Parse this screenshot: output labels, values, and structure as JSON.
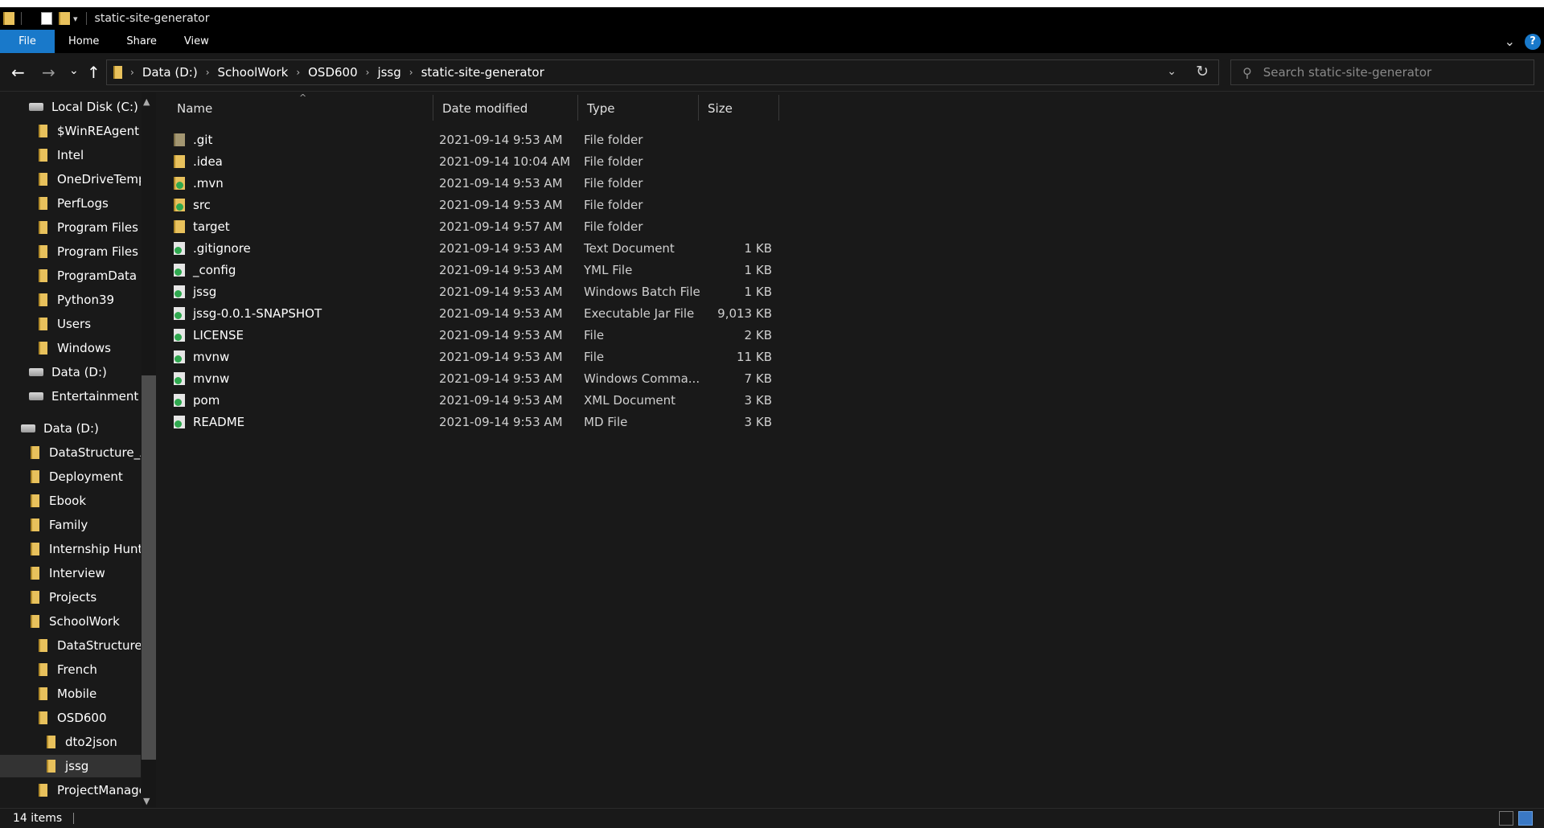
{
  "window": {
    "title": "static-site-generator"
  },
  "ribbon": {
    "tabs": [
      "File",
      "Home",
      "Share",
      "View"
    ]
  },
  "address": {
    "crumbs": [
      "Data (D:)",
      "SchoolWork",
      "OSD600",
      "jssg",
      "static-site-generator"
    ]
  },
  "search": {
    "placeholder": "Search static-site-generator"
  },
  "nav": {
    "items": [
      {
        "label": "Local Disk (C:)",
        "icon": "drive-icon"
      },
      {
        "label": "$WinREAgent",
        "icon": "folder-icon"
      },
      {
        "label": "Intel",
        "icon": "folder-icon"
      },
      {
        "label": "OneDriveTemp",
        "icon": "folder-icon"
      },
      {
        "label": "PerfLogs",
        "icon": "folder-icon"
      },
      {
        "label": "Program Files",
        "icon": "folder-icon"
      },
      {
        "label": "Program Files (",
        "icon": "folder-icon"
      },
      {
        "label": "ProgramData",
        "icon": "folder-icon"
      },
      {
        "label": "Python39",
        "icon": "folder-icon"
      },
      {
        "label": "Users",
        "icon": "folder-icon"
      },
      {
        "label": "Windows",
        "icon": "folder-icon"
      },
      {
        "label": "Data (D:)",
        "icon": "drive-icon"
      },
      {
        "label": "Entertainment (E",
        "icon": "drive-icon"
      },
      {
        "label": "Data (D:)",
        "icon": "drive-icon"
      },
      {
        "label": "DataStructure_Al",
        "icon": "folder-icon"
      },
      {
        "label": "Deployment",
        "icon": "folder-icon"
      },
      {
        "label": "Ebook",
        "icon": "folder-icon"
      },
      {
        "label": "Family",
        "icon": "folder-icon"
      },
      {
        "label": "Internship Huntir",
        "icon": "folder-icon"
      },
      {
        "label": "Interview",
        "icon": "folder-icon"
      },
      {
        "label": "Projects",
        "icon": "folder-icon"
      },
      {
        "label": "SchoolWork",
        "icon": "folder-icon"
      },
      {
        "label": "DataStructureA",
        "icon": "folder-icon"
      },
      {
        "label": "French",
        "icon": "folder-icon"
      },
      {
        "label": "Mobile",
        "icon": "folder-icon"
      },
      {
        "label": "OSD600",
        "icon": "folder-icon"
      },
      {
        "label": "dto2json",
        "icon": "folder-icon"
      },
      {
        "label": "jssg",
        "icon": "folder-icon",
        "selected": true
      },
      {
        "label": "ProjectManage",
        "icon": "folder-icon"
      }
    ]
  },
  "columns": {
    "name": "Name",
    "date": "Date modified",
    "type": "Type",
    "size": "Size"
  },
  "files": [
    {
      "name": ".git",
      "date": "2021-09-14 9:53 AM",
      "type": "File folder",
      "size": "",
      "icon": "folder-dim"
    },
    {
      "name": ".idea",
      "date": "2021-09-14 10:04 AM",
      "type": "File folder",
      "size": "",
      "icon": "folder-plain"
    },
    {
      "name": ".mvn",
      "date": "2021-09-14 9:53 AM",
      "type": "File folder",
      "size": "",
      "icon": "folder-green"
    },
    {
      "name": "src",
      "date": "2021-09-14 9:53 AM",
      "type": "File folder",
      "size": "",
      "icon": "folder-green"
    },
    {
      "name": "target",
      "date": "2021-09-14 9:57 AM",
      "type": "File folder",
      "size": "",
      "icon": "folder-plain"
    },
    {
      "name": ".gitignore",
      "date": "2021-09-14 9:53 AM",
      "type": "Text Document",
      "size": "1 KB",
      "icon": "doc-green"
    },
    {
      "name": "_config",
      "date": "2021-09-14 9:53 AM",
      "type": "YML File",
      "size": "1 KB",
      "icon": "doc-green"
    },
    {
      "name": "jssg",
      "date": "2021-09-14 9:53 AM",
      "type": "Windows Batch File",
      "size": "1 KB",
      "icon": "doc-green"
    },
    {
      "name": "jssg-0.0.1-SNAPSHOT",
      "date": "2021-09-14 9:53 AM",
      "type": "Executable Jar File",
      "size": "9,013 KB",
      "icon": "doc-green"
    },
    {
      "name": "LICENSE",
      "date": "2021-09-14 9:53 AM",
      "type": "File",
      "size": "2 KB",
      "icon": "doc-green"
    },
    {
      "name": "mvnw",
      "date": "2021-09-14 9:53 AM",
      "type": "File",
      "size": "11 KB",
      "icon": "doc-green"
    },
    {
      "name": "mvnw",
      "date": "2021-09-14 9:53 AM",
      "type": "Windows Comma...",
      "size": "7 KB",
      "icon": "doc-green"
    },
    {
      "name": "pom",
      "date": "2021-09-14 9:53 AM",
      "type": "XML Document",
      "size": "3 KB",
      "icon": "doc-green"
    },
    {
      "name": "README",
      "date": "2021-09-14 9:53 AM",
      "type": "MD File",
      "size": "3 KB",
      "icon": "doc-green"
    }
  ],
  "status": {
    "item_count": "14 items"
  },
  "icons": {
    "back": "←",
    "forward": "→",
    "recent": "⌄",
    "up": "↑",
    "refresh": "↻",
    "search": "⚲",
    "chevron": "⌄",
    "help": "?"
  }
}
